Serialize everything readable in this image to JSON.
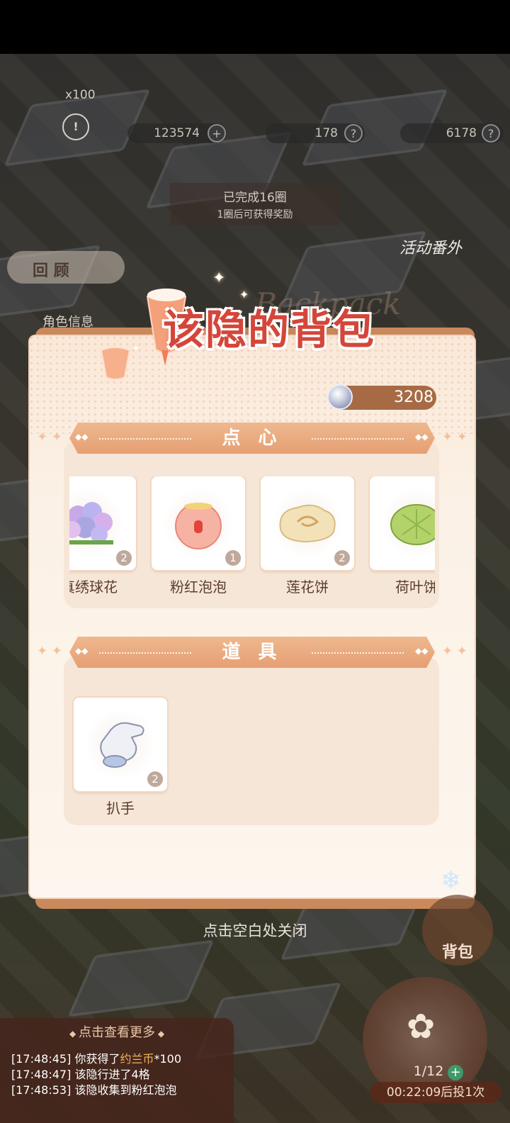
{
  "background": {
    "coin_reward": "x100",
    "resource_1": "123574",
    "resource_2": "178",
    "resource_3": "6178",
    "laps_done": "已完成16圈",
    "laps_note": "1圈后可获得奖励",
    "review_label": "回 顾",
    "event_label": "活动番外",
    "role_info": "角色信息"
  },
  "panel": {
    "title": "该隐的背包",
    "title_decoration": "Backpack",
    "currency_value": "3208",
    "sections": [
      {
        "title": "点 心",
        "items": [
          {
            "name": "真绣球花",
            "count": "2"
          },
          {
            "name": "粉红泡泡",
            "count": "1"
          },
          {
            "name": "莲花饼",
            "count": "2"
          },
          {
            "name": "荷叶饼",
            "count": ""
          }
        ]
      },
      {
        "title": "道 具",
        "items": [
          {
            "name": "扒手",
            "count": "2"
          }
        ]
      }
    ]
  },
  "close_hint": "点击空白处关闭",
  "log": {
    "header": "点击查看更多",
    "lines": [
      {
        "time": "[17:48:45]",
        "pre": "你获得了",
        "hl": "约兰币",
        "post": "*100"
      },
      {
        "time": "[17:48:47]",
        "pre": "该隐行进了4格",
        "hl": "",
        "post": ""
      },
      {
        "time": "[17:48:53]",
        "pre": "该隐收集到粉红泡泡",
        "hl": "",
        "post": ""
      }
    ]
  },
  "widgets": {
    "backpack_label": "背包",
    "turns": "1/12",
    "timer": "00:22:09后投1次"
  }
}
